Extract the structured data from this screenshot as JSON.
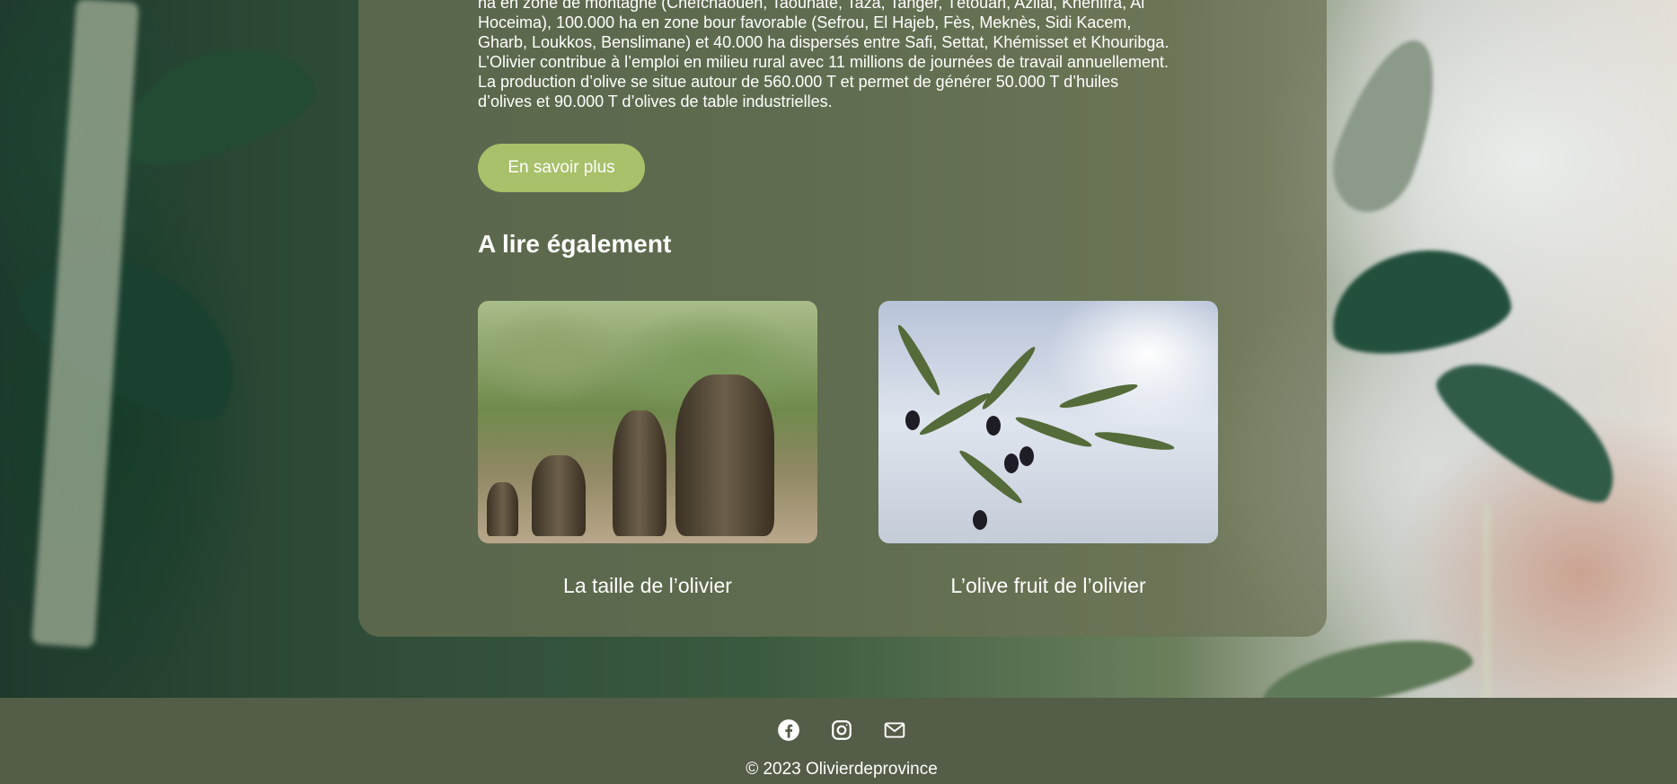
{
  "intro": {
    "lines": [
      "ha en zone de montagne (Chefchaouen, Taounate, Taza, Tanger, Tétouan, Azilal, Khénifra, Al",
      "Hoceima), 100.000 ha en zone bour favorable (Sefrou, El Hajeb, Fès, Meknès, Sidi Kacem,",
      "Gharb, Loukkos, Benslimane) et 40.000 ha dispersés entre Safi, Settat, Khémisset et Khouribga.",
      "L’Olivier contribue à l’emploi en milieu rural avec 11 millions de journées de travail annuellement.",
      "La production d’olive se situe autour de 560.000 T et permet de générer 50.000 T d’huiles",
      "d’olives et 90.000 T d’olives de table industrielles."
    ]
  },
  "cta": {
    "label": "En savoir plus"
  },
  "related": {
    "title": "A lire également",
    "cards": [
      {
        "caption": "La taille de l’olivier"
      },
      {
        "caption": "L’olive fruit de l’olivier"
      }
    ]
  },
  "footer": {
    "icons": [
      "facebook-icon",
      "instagram-icon",
      "mail-icon"
    ],
    "copyright": "© 2023 Olivierdeprovince"
  },
  "colors": {
    "accent": "#a8c16a",
    "footer_bg": "#545d47"
  }
}
